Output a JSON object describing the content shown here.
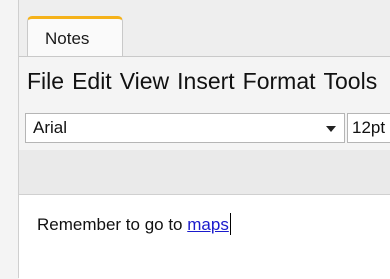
{
  "tabs": [
    {
      "label": "Notes",
      "active": true
    }
  ],
  "menu": {
    "items": [
      "File",
      "Edit",
      "View",
      "Insert",
      "Format",
      "Tools"
    ]
  },
  "format": {
    "font_family": "Arial",
    "font_size": "12pt"
  },
  "editor": {
    "text_before_link": "Remember to go to ",
    "link_text": "maps"
  },
  "colors": {
    "active_tab_accent": "#f5b21a",
    "link": "#1a1acc"
  },
  "icons": {
    "font_dropdown": "chevron-down-icon"
  }
}
